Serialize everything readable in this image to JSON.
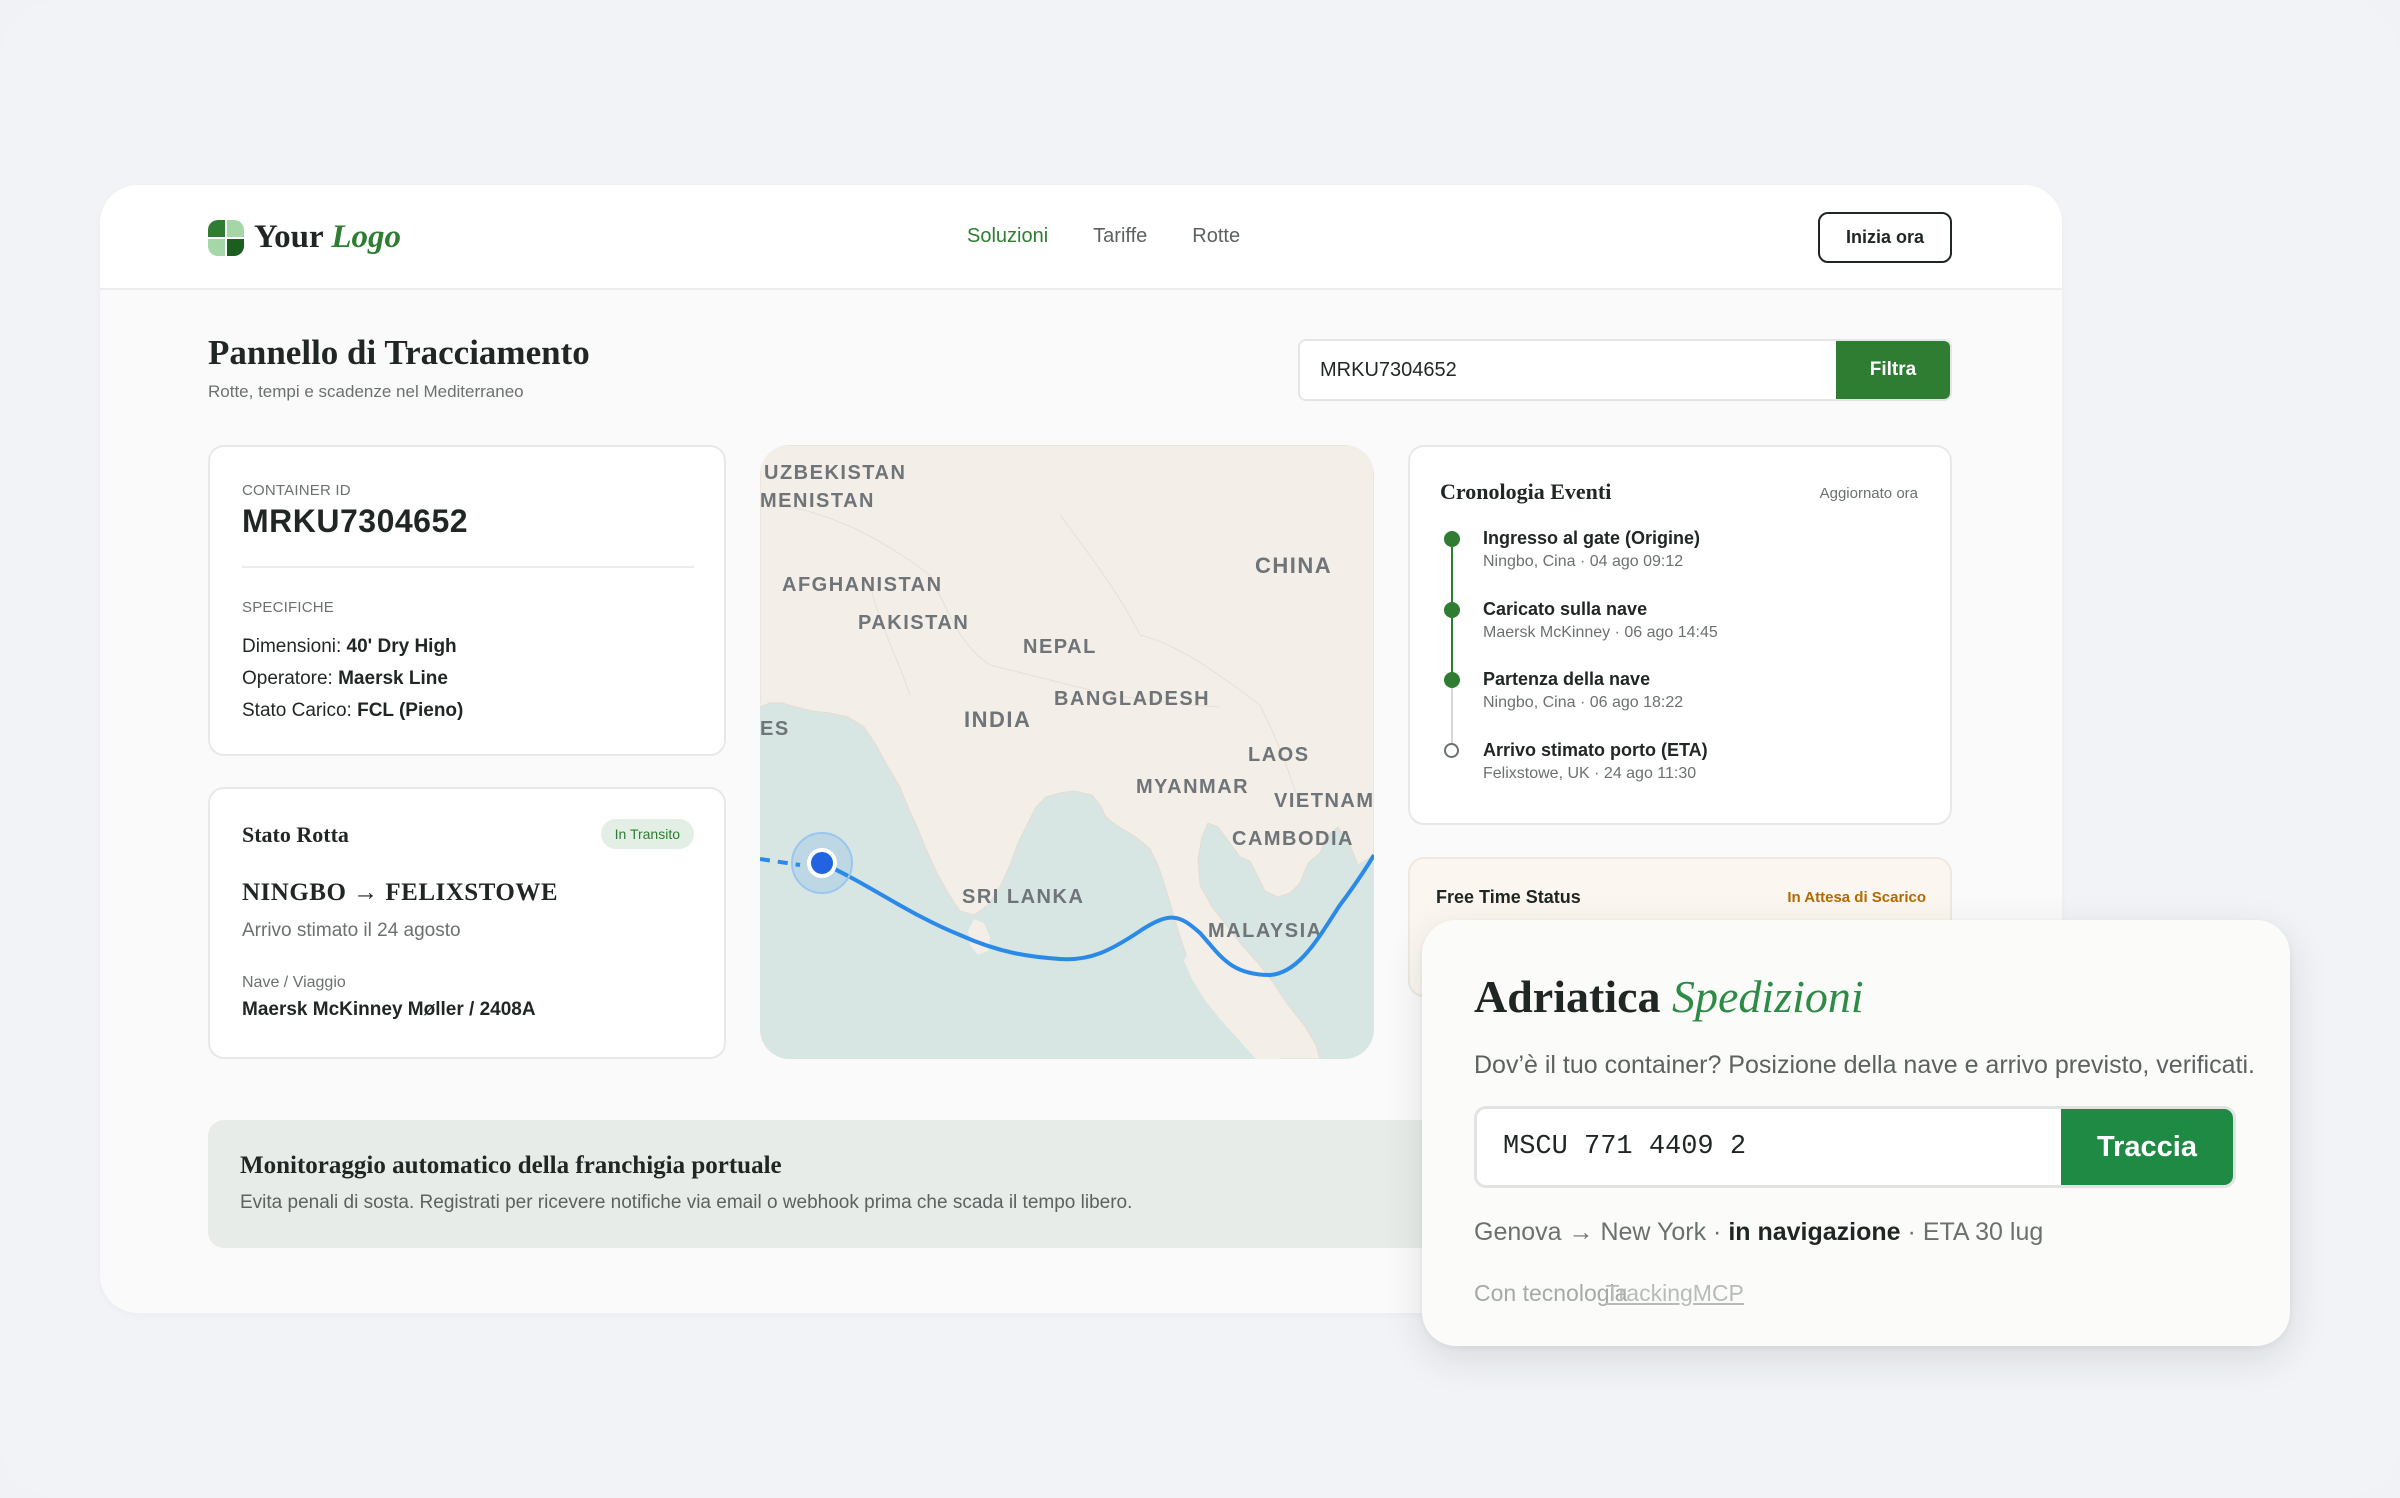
{
  "brand": {
    "name": "Your",
    "name_accent": "Logo"
  },
  "nav": {
    "items": [
      {
        "label": "Soluzioni",
        "active": true
      },
      {
        "label": "Tariffe",
        "active": false
      },
      {
        "label": "Rotte",
        "active": false
      }
    ]
  },
  "header": {
    "cta": "Inizia ora"
  },
  "page": {
    "title": "Pannello di Tracciamento",
    "subtitle": "Rotte, tempi e scadenze nel Mediterraneo"
  },
  "filter": {
    "value": "MRKU7304652",
    "button": "Filtra"
  },
  "container": {
    "id_label": "CONTAINER ID",
    "id": "MRKU7304652",
    "specs_label": "SPECIFICHE",
    "specs": [
      {
        "key": "Dimensioni:",
        "value": "40' Dry High"
      },
      {
        "key": "Operatore:",
        "value": "Maersk Line"
      },
      {
        "key": "Stato Carico:",
        "value": "FCL (Pieno)"
      }
    ]
  },
  "route": {
    "title": "Stato Rotta",
    "badge": "In Transito",
    "path": "NINGBO → FELIXSTOWE",
    "eta": "Arrivo stimato il 24 agosto",
    "vessel_label": "Nave / Viaggio",
    "vessel": "Maersk McKinney Møller / 2408A"
  },
  "map": {
    "labels": [
      "UZBEKISTAN",
      "MENISTAN",
      "AFGHANISTAN",
      "PAKISTAN",
      "CHINA",
      "NEPAL",
      "BANGLADESH",
      "INDIA",
      "LAOS",
      "MYANMAR",
      "VIETNAM",
      "CAMBODIA",
      "SRI LANKA",
      "MALAYSIA",
      "ES"
    ]
  },
  "timeline": {
    "title": "Cronologia Eventi",
    "updated": "Aggiornato ora",
    "events": [
      {
        "title": "Ingresso al gate (Origine)",
        "detail": "Ningbo, Cina · 04 ago 09:12",
        "done": true
      },
      {
        "title": "Caricato sulla nave",
        "detail": "Maersk McKinney · 06 ago 14:45",
        "done": true
      },
      {
        "title": "Partenza della nave",
        "detail": "Ningbo, Cina · 06 ago 18:22",
        "done": true
      },
      {
        "title": "Arrivo stimato porto (ETA)",
        "detail": "Felixstowe, UK · 24 ago 11:30",
        "done": false
      }
    ]
  },
  "freetime": {
    "title": "Free Time Status",
    "status": "In Attesa di Scarico"
  },
  "banner": {
    "title": "Monitoraggio automatico della franchigia portuale",
    "subtitle": "Evita penali di sosta. Registrati per ricevere notifiche via email o webhook prima che scada il tempo libero."
  },
  "widget": {
    "title": "Adriatica",
    "title_accent": "Spedizioni",
    "description": "Dov’è il tuo container? Posizione della nave e arrivo previsto, verificati.",
    "input_value": "MSCU 771 4409 2",
    "button": "Traccia",
    "route": "Genova → New York",
    "sep1": "·",
    "state": "in navigazione",
    "sep2": "·",
    "eta": "ETA 30 lug",
    "powered_prefix": "Con tecnologia",
    "powered_brand": "TrackingMCP"
  },
  "colors": {
    "brand_green": "#2e7d32",
    "widget_green": "#1e8a43",
    "route_blue": "#2b8ae8",
    "pending_amber": "#b26a00"
  }
}
